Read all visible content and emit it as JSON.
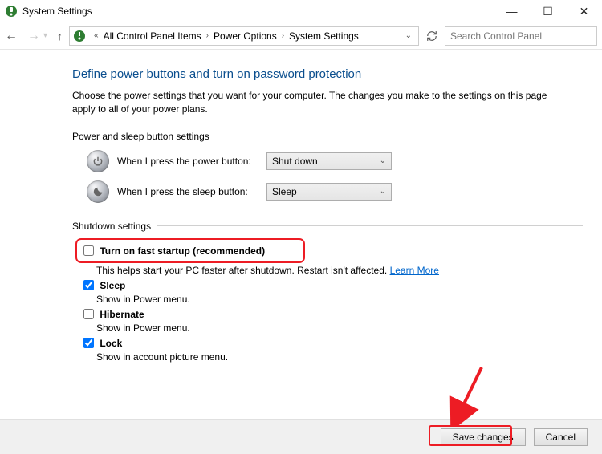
{
  "title": "System Settings",
  "breadcrumb": {
    "item1": "All Control Panel Items",
    "item2": "Power Options",
    "item3": "System Settings"
  },
  "search": {
    "placeholder": "Search Control Panel"
  },
  "page": {
    "heading": "Define power buttons and turn on password protection",
    "description": "Choose the power settings that you want for your computer. The changes you make to the settings on this page apply to all of your power plans."
  },
  "buttons_section": {
    "title": "Power and sleep button settings",
    "power_label": "When I press the power button:",
    "power_value": "Shut down",
    "sleep_label": "When I press the sleep button:",
    "sleep_value": "Sleep"
  },
  "shutdown_section": {
    "title": "Shutdown settings",
    "fast": {
      "title": "Turn on fast startup (recommended)",
      "sub": "This helps start your PC faster after shutdown. Restart isn't affected. ",
      "link": "Learn More",
      "checked": false
    },
    "sleep": {
      "title": "Sleep",
      "sub": "Show in Power menu.",
      "checked": true
    },
    "hibernate": {
      "title": "Hibernate",
      "sub": "Show in Power menu.",
      "checked": false
    },
    "lock": {
      "title": "Lock",
      "sub": "Show in account picture menu.",
      "checked": true
    }
  },
  "actions": {
    "save": "Save changes",
    "cancel": "Cancel"
  }
}
